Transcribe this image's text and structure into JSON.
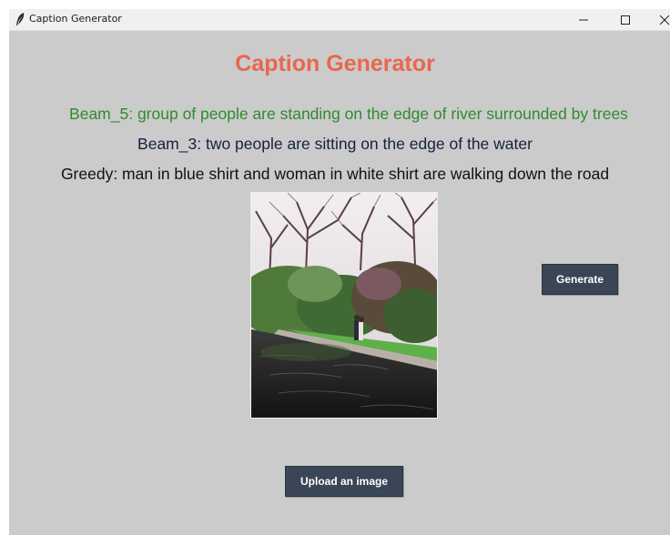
{
  "window": {
    "title": "Caption Generator",
    "icon": "feather-icon",
    "controls": [
      "minimize-icon",
      "maximize-icon",
      "close-icon"
    ]
  },
  "main": {
    "heading": "Caption Generator",
    "captions": {
      "beam5": "Beam_5: group of people are standing on the edge of river surrounded by trees",
      "beam3": "Beam_3: two people are sitting on the edge of the water",
      "greedy": "Greedy: man in blue shirt and woman in white shirt are walking down the road"
    },
    "image": "park-river-photo",
    "generate_label": "Generate",
    "upload_label": "Upload an image"
  },
  "colors": {
    "background": "#cbcbcb",
    "heading": "#e8674d",
    "beam5_text": "#2e8b2e",
    "beam3_text": "#16213e",
    "greedy_text": "#111111",
    "button_bg": "#3a4556",
    "button_text": "#ffffff"
  }
}
